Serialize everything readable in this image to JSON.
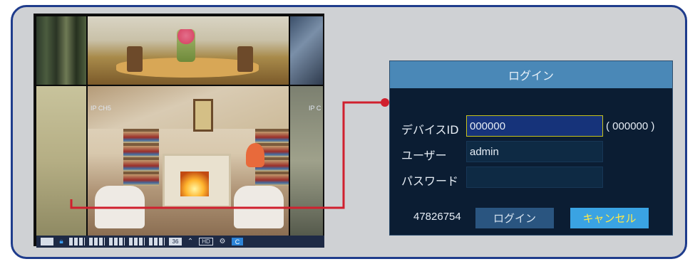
{
  "camera_view": {
    "channels": [
      {
        "label": "IP CH5"
      },
      {
        "label": "IP C"
      }
    ],
    "toolbar": {
      "channel_count": "36",
      "hd_label": "HD"
    }
  },
  "login_dialog": {
    "title": "ログイン",
    "device_id_label": "デバイスID",
    "device_id_value": "000000",
    "device_id_hint": "( 000000 )",
    "user_label": "ユーザー",
    "user_value": "admin",
    "password_label": "パスワード",
    "password_value": "",
    "device_code": "47826754",
    "login_button": "ログイン",
    "cancel_button": "キャンセル"
  },
  "colors": {
    "frame_border": "#1f3c8c",
    "frame_bg": "#cfd1d4",
    "connector": "#d0202e",
    "dialog_title_bg": "#4a88b7",
    "dialog_bg": "#0b1d33",
    "cancel_text": "#ffe94a"
  }
}
